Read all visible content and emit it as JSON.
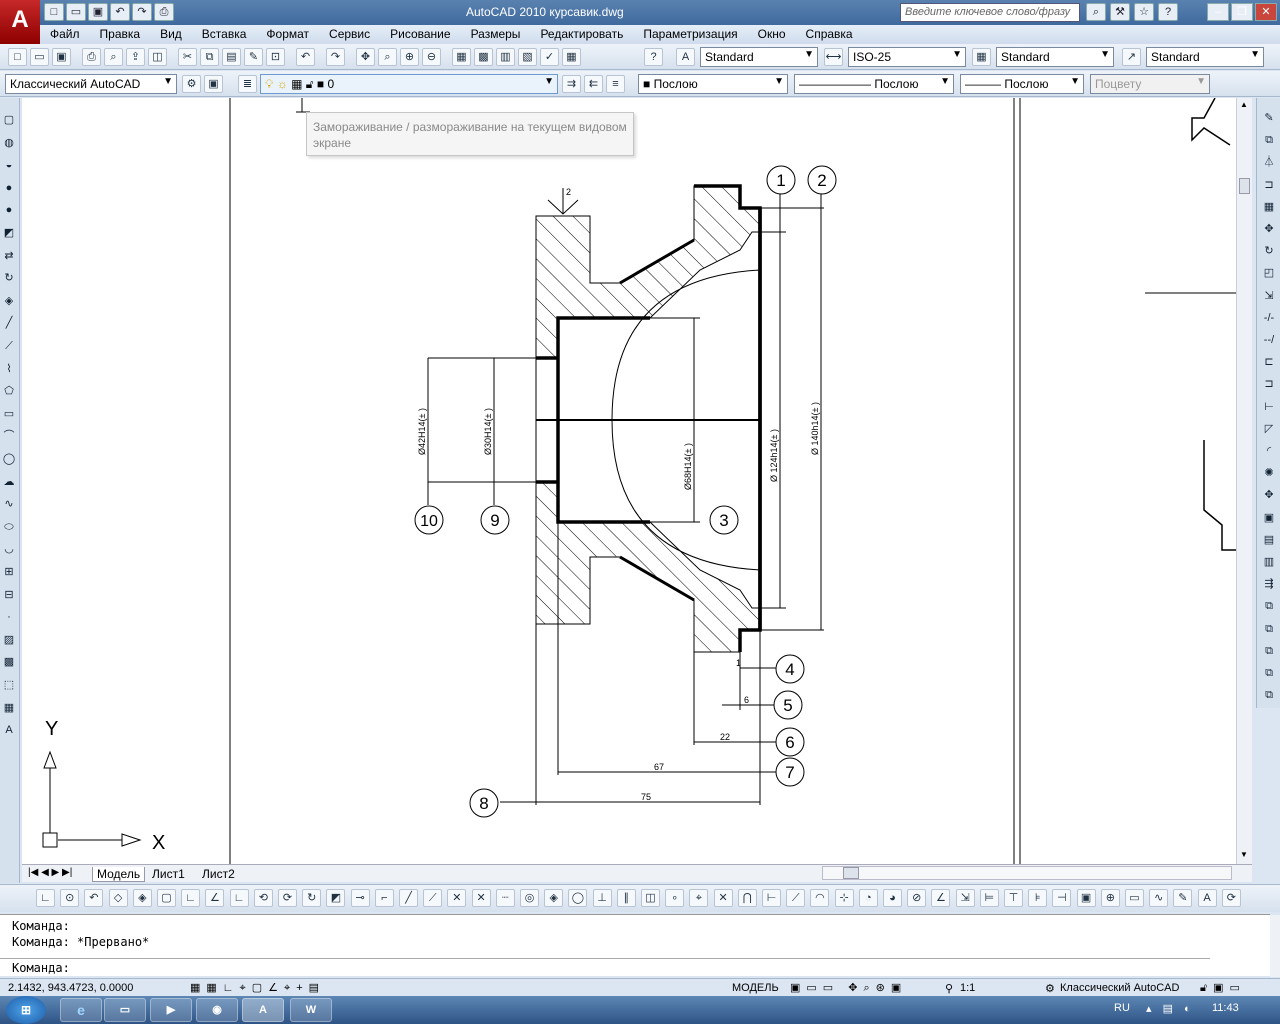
{
  "window": {
    "title": "AutoCAD 2010     курсавик.dwg",
    "logo": "A",
    "search_placeholder": "Введите ключевое слово/фразу"
  },
  "menu": [
    "Файл",
    "Правка",
    "Вид",
    "Вставка",
    "Формат",
    "Сервис",
    "Рисование",
    "Размеры",
    "Редактировать",
    "Параметризация",
    "Окно",
    "Справка"
  ],
  "styles": {
    "text_style": "Standard",
    "dim_style": "ISO-25",
    "table_style": "Standard",
    "mleader_style": "Standard"
  },
  "workspace": "Классический AutoCAD",
  "layer": {
    "name": "0"
  },
  "properties": {
    "color": "Послою",
    "linetype": "Послою",
    "lineweight": "Послою",
    "plotstyle": "Поцвету"
  },
  "tooltip": "Замораживание / размораживание на текущем видовом экране",
  "drawing": {
    "balloons": [
      "1",
      "2",
      "3",
      "4",
      "5",
      "6",
      "7",
      "8",
      "9",
      "10"
    ],
    "dims": {
      "d42": "Ø42H14(±   )",
      "d30": "Ø30H14(±   )",
      "d68": "Ø68H14(±   )",
      "d124": "Ø 124h14(±   )",
      "d140": "Ø 140h14(±   )",
      "l1": "1",
      "l6": "6",
      "l22": "22",
      "l67": "67",
      "l75": "75",
      "rough": "2"
    },
    "ucs_x": "X",
    "ucs_y": "Y"
  },
  "layout_tabs": [
    "Модель",
    "Лист1",
    "Лист2"
  ],
  "command": {
    "line1": "Команда:",
    "line2": "Команда: *Прервано*",
    "prompt": "Команда:"
  },
  "status": {
    "coords": "2.1432, 943.4723, 0.0000",
    "space": "МОДЕЛЬ",
    "scale": "1:1",
    "workspace": "Классический AutoCAD"
  },
  "taskbar": {
    "lang": "RU",
    "time": "11:43"
  },
  "colors": {
    "titlebar": "#3f6a9e",
    "logo": "#c62828",
    "canvas": "#ffffff"
  }
}
